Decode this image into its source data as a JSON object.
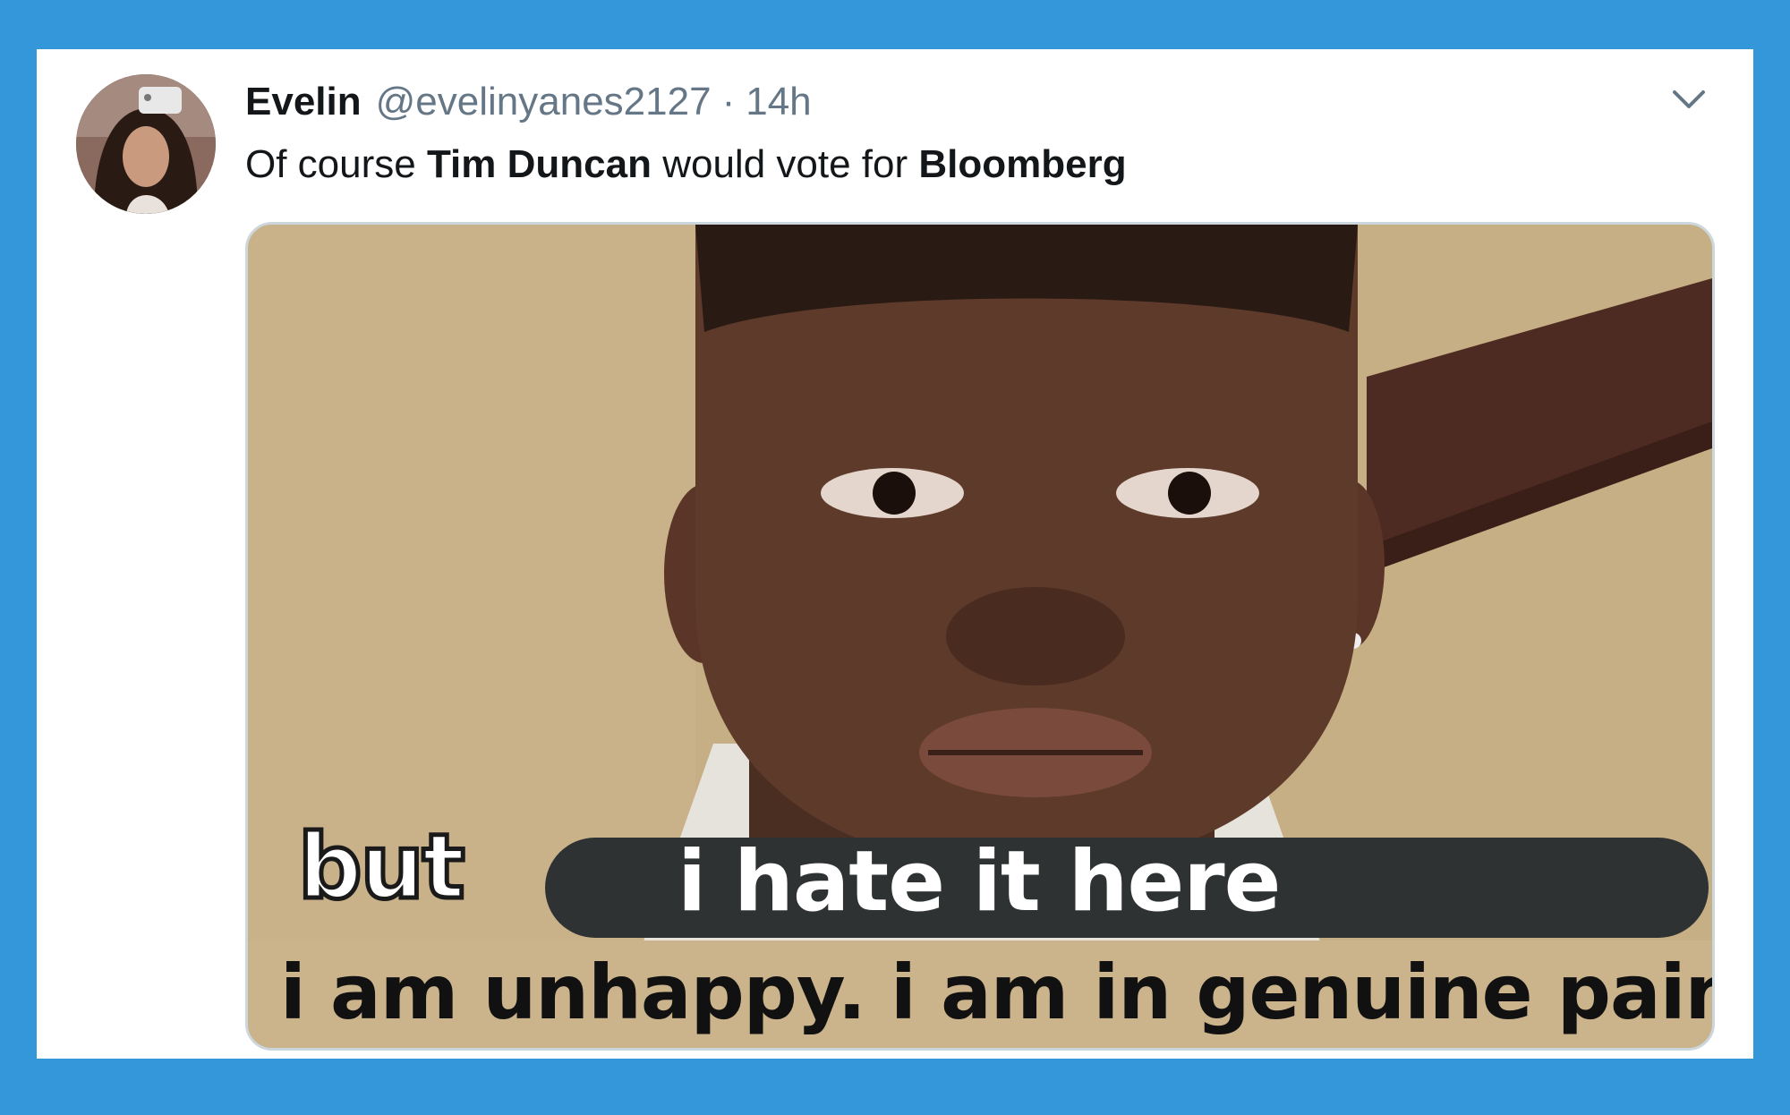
{
  "tweet": {
    "display_name": "Evelin",
    "handle": "@evelinyanes2127",
    "separator": "·",
    "time": "14h",
    "text_parts": {
      "p1": "Of course ",
      "b1": "Tim Duncan",
      "p2": " would vote for ",
      "b2": "Bloomberg"
    }
  },
  "media": {
    "caption_but": "but",
    "caption_highlight": "i hate it here",
    "caption_bottom": "i am unhappy. i am in genuine pain."
  },
  "icons": {
    "menu": "chevron-down-icon"
  },
  "colors": {
    "frame_background": "#3497da",
    "card_background": "#ffffff",
    "primary_text": "#14171a",
    "secondary_text": "#657786",
    "media_border": "#ccd6dd"
  }
}
